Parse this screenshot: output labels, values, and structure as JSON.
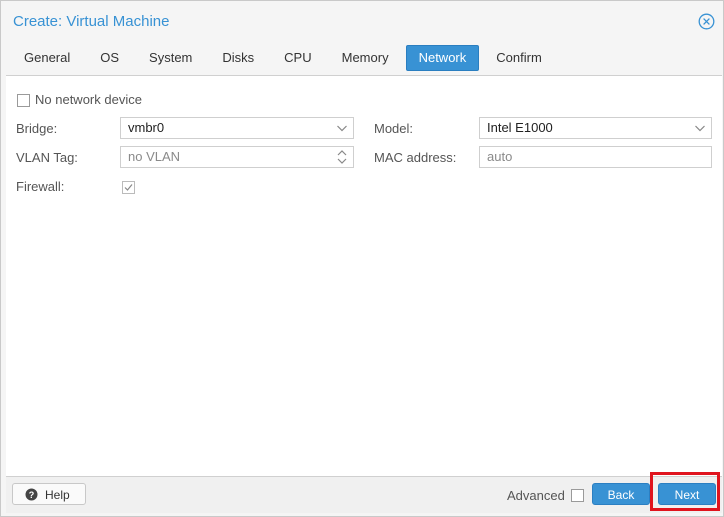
{
  "dialog": {
    "title": "Create: Virtual Machine",
    "close_icon": "close-circle-icon"
  },
  "tabs": [
    {
      "label": "General"
    },
    {
      "label": "OS"
    },
    {
      "label": "System"
    },
    {
      "label": "Disks"
    },
    {
      "label": "CPU"
    },
    {
      "label": "Memory"
    },
    {
      "label": "Network",
      "active": true
    },
    {
      "label": "Confirm"
    }
  ],
  "form": {
    "no_network_device": {
      "label": "No network device",
      "checked": false
    },
    "bridge": {
      "label": "Bridge:",
      "value": "vmbr0"
    },
    "vlan_tag": {
      "label": "VLAN Tag:",
      "value": "no VLAN"
    },
    "firewall": {
      "label": "Firewall:",
      "checked": true
    },
    "model": {
      "label": "Model:",
      "value": "Intel E1000"
    },
    "mac_address": {
      "label": "MAC address:",
      "value": "auto"
    }
  },
  "footer": {
    "help_label": "Help",
    "advanced_label": "Advanced",
    "advanced_checked": false,
    "back_label": "Back",
    "next_label": "Next"
  },
  "colors": {
    "accent": "#3892d4",
    "highlight": "#e0141e"
  }
}
